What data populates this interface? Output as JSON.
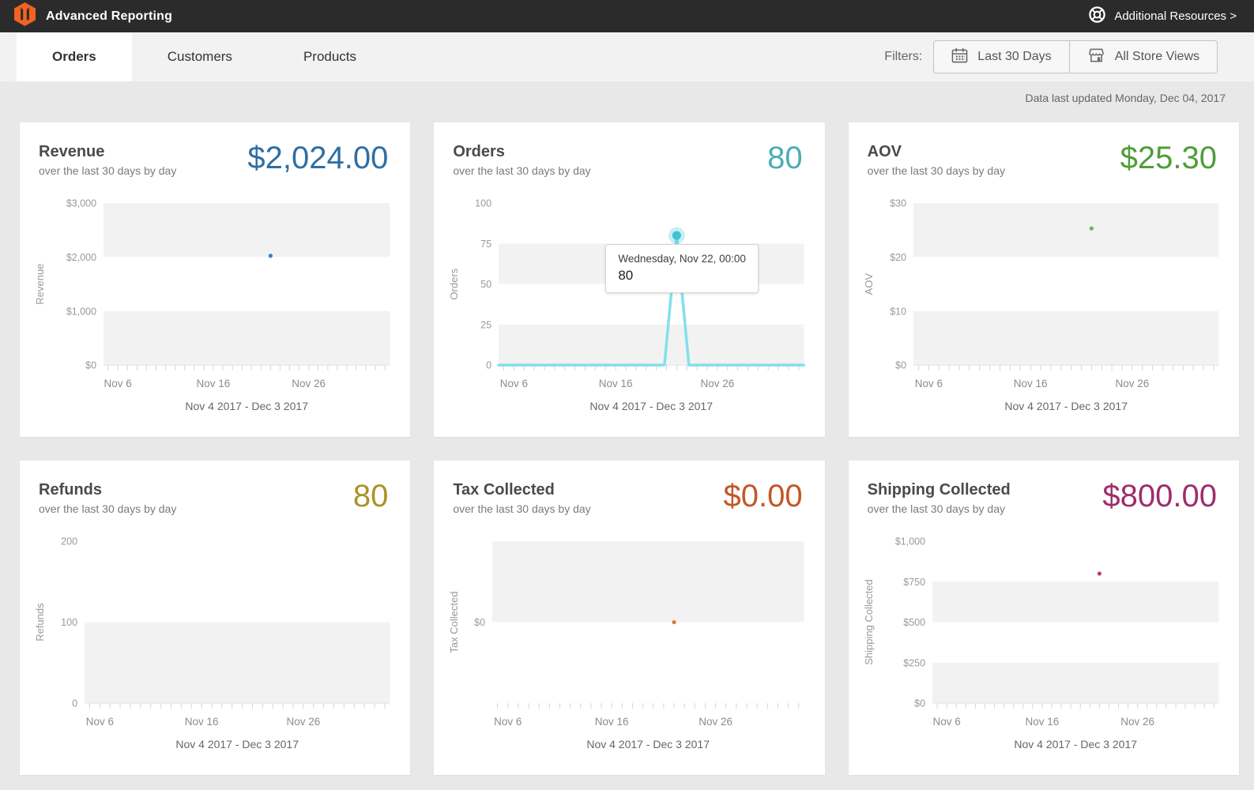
{
  "header": {
    "title": "Advanced Reporting",
    "resources_label": "Additional Resources >"
  },
  "tabs": [
    {
      "label": "Orders",
      "active": true
    },
    {
      "label": "Customers",
      "active": false
    },
    {
      "label": "Products",
      "active": false
    }
  ],
  "filters": {
    "label": "Filters:",
    "buttons": [
      {
        "icon": "calendar-icon",
        "label": "Last 30 Days"
      },
      {
        "icon": "store-icon",
        "label": "All Store Views"
      }
    ]
  },
  "last_updated": "Data last updated Monday, Dec 04, 2017",
  "colors": {
    "header_bg": "#2b2b2b",
    "logo_orange": "#f26322",
    "page_bg": "#e8e8e8",
    "band_gray": "#f2f2f2",
    "axis_text": "#999999",
    "date_text": "#8c8c8c",
    "footer_text": "#666666",
    "tick": "#d6d6d6"
  },
  "chart_data": [
    {
      "key": "revenue",
      "type": "scatter",
      "title": "Revenue",
      "subtitle": "over the last 30 days by day",
      "summary_value": "$2,024.00",
      "summary_color": "#2f6ea5",
      "ylabel": "Revenue",
      "ylim": [
        0,
        3000
      ],
      "yticks": [
        {
          "label": "$3,000",
          "v": 3000
        },
        {
          "label": "$2,000",
          "v": 2000
        },
        {
          "label": "$1,000",
          "v": 1000
        },
        {
          "label": "$0",
          "v": 0
        }
      ],
      "bands": [
        [
          2000,
          3000
        ],
        [
          0,
          1000
        ]
      ],
      "xticks": [
        {
          "label": "Nov 6",
          "day": 2
        },
        {
          "label": "Nov 16",
          "day": 12
        },
        {
          "label": "Nov 26",
          "day": 22
        }
      ],
      "days": 30,
      "x_range_label": "Nov 4 2017 - Dec 3 2017",
      "points": [
        {
          "date": "Nov 22",
          "day": 18,
          "value": 2024,
          "color": "#3f7fc1"
        }
      ],
      "grid": "bands",
      "legend": "none"
    },
    {
      "key": "orders",
      "type": "line",
      "title": "Orders",
      "subtitle": "over the last 30 days by day",
      "summary_value": "80",
      "summary_color": "#4aadb5",
      "ylabel": "Orders",
      "ylim": [
        0,
        100
      ],
      "yticks": [
        {
          "label": "100",
          "v": 100
        },
        {
          "label": "75",
          "v": 75
        },
        {
          "label": "50",
          "v": 50
        },
        {
          "label": "25",
          "v": 25
        },
        {
          "label": "0",
          "v": 0
        }
      ],
      "bands": [
        [
          50,
          75
        ],
        [
          0,
          25
        ]
      ],
      "xticks": [
        {
          "label": "Nov 6",
          "day": 2
        },
        {
          "label": "Nov 16",
          "day": 12
        },
        {
          "label": "Nov 26",
          "day": 22
        }
      ],
      "days": 30,
      "x_range_label": "Nov 4 2017 - Dec 3 2017",
      "line": {
        "color": "#84dfec",
        "baseline": 0,
        "peak": {
          "date": "Nov 22",
          "day": 18,
          "value": 80
        },
        "marker_color": "#3cc3d5"
      },
      "points": [],
      "tooltip": {
        "title": "Wednesday, Nov 22, 00:00",
        "value": "80"
      },
      "grid": "bands",
      "legend": "none"
    },
    {
      "key": "aov",
      "type": "scatter",
      "title": "AOV",
      "subtitle": "over the last 30 days by day",
      "summary_value": "$25.30",
      "summary_color": "#4f9d3a",
      "ylabel": "AOV",
      "ylim": [
        0,
        30
      ],
      "yticks": [
        {
          "label": "$30",
          "v": 30
        },
        {
          "label": "$20",
          "v": 20
        },
        {
          "label": "$10",
          "v": 10
        },
        {
          "label": "$0",
          "v": 0
        }
      ],
      "bands": [
        [
          20,
          30
        ],
        [
          0,
          10
        ]
      ],
      "xticks": [
        {
          "label": "Nov 6",
          "day": 2
        },
        {
          "label": "Nov 16",
          "day": 12
        },
        {
          "label": "Nov 26",
          "day": 22
        }
      ],
      "days": 30,
      "x_range_label": "Nov 4 2017 - Dec 3 2017",
      "points": [
        {
          "date": "Nov 22",
          "day": 18,
          "value": 25.3,
          "color": "#6cb85a"
        }
      ],
      "grid": "bands",
      "legend": "none"
    },
    {
      "key": "refunds",
      "type": "scatter",
      "title": "Refunds",
      "subtitle": "over the last 30 days by day",
      "summary_value": "80",
      "summary_color": "#ac9229",
      "ylabel": "Refunds",
      "ylim": [
        0,
        200
      ],
      "yticks": [
        {
          "label": "200",
          "v": 200
        },
        {
          "label": "100",
          "v": 100
        },
        {
          "label": "0",
          "v": 0
        }
      ],
      "bands": [
        [
          0,
          100
        ]
      ],
      "xticks": [
        {
          "label": "Nov 6",
          "day": 2
        },
        {
          "label": "Nov 16",
          "day": 12
        },
        {
          "label": "Nov 26",
          "day": 22
        }
      ],
      "days": 30,
      "x_range_label": "Nov 4 2017 - Dec 3 2017",
      "points": [],
      "grid": "bands",
      "legend": "none"
    },
    {
      "key": "tax-collected",
      "type": "scatter",
      "title": "Tax Collected",
      "subtitle": "over the last 30 days by day",
      "summary_value": "$0.00",
      "summary_color": "#c35727",
      "ylabel": "Tax Collected",
      "ylim": [
        -1,
        1
      ],
      "yticks": [
        {
          "label": "$0",
          "v": 0
        }
      ],
      "bands": [
        [
          0,
          1
        ]
      ],
      "no_bottom_axis": true,
      "xticks": [
        {
          "label": "Nov 6",
          "day": 2
        },
        {
          "label": "Nov 16",
          "day": 12
        },
        {
          "label": "Nov 26",
          "day": 22
        }
      ],
      "days": 30,
      "x_range_label": "Nov 4 2017 - Dec 3 2017",
      "points": [
        {
          "date": "Nov 22",
          "day": 18,
          "value": 0,
          "color": "#e5753f"
        }
      ],
      "grid": "bands",
      "legend": "none"
    },
    {
      "key": "shipping-collected",
      "type": "scatter",
      "title": "Shipping Collected",
      "subtitle": "over the last 30 days by day",
      "summary_value": "$800.00",
      "summary_color": "#9d2e6a",
      "ylabel": "Shipping Collected",
      "ylim": [
        0,
        1000
      ],
      "yticks": [
        {
          "label": "$1,000",
          "v": 1000
        },
        {
          "label": "$750",
          "v": 750
        },
        {
          "label": "$500",
          "v": 500
        },
        {
          "label": "$250",
          "v": 250
        },
        {
          "label": "$0",
          "v": 0
        }
      ],
      "bands": [
        [
          500,
          750
        ],
        [
          0,
          250
        ]
      ],
      "xticks": [
        {
          "label": "Nov 6",
          "day": 2
        },
        {
          "label": "Nov 16",
          "day": 12
        },
        {
          "label": "Nov 26",
          "day": 22
        }
      ],
      "days": 30,
      "x_range_label": "Nov 4 2017 - Dec 3 2017",
      "points": [
        {
          "date": "Nov 22",
          "day": 18,
          "value": 800,
          "color": "#bb3b7c"
        }
      ],
      "grid": "bands",
      "legend": "none"
    }
  ]
}
